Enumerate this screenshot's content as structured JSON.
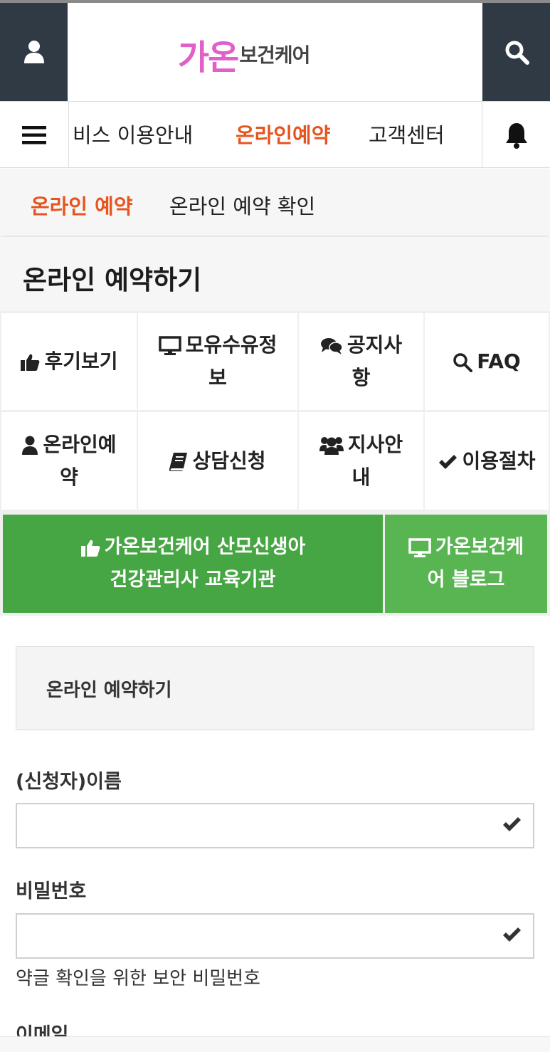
{
  "header": {
    "logo_mark": "가온",
    "logo_rest": "보건케어",
    "user_icon": "user-icon",
    "search_icon": "search-icon"
  },
  "gnb": {
    "items": [
      "비스 이용안내",
      "온라인예약",
      "고객센터"
    ],
    "active_index": 1,
    "menu_icon": "hamburger-icon",
    "bell_icon": "bell-icon"
  },
  "subnav": {
    "items": [
      "온라인 예약",
      "온라인 예약 확인"
    ],
    "active_index": 0
  },
  "page_title": "온라인 예약하기",
  "quick_menu": [
    {
      "label": "후기보기",
      "icon": "thumbs-up-icon"
    },
    {
      "label": "모유수유정보",
      "icon": "monitor-icon"
    },
    {
      "label": "공지사항",
      "icon": "comments-icon"
    },
    {
      "label": "FAQ",
      "icon": "search-icon"
    },
    {
      "label": "온라인예약",
      "icon": "user-icon"
    },
    {
      "label": "상담신청",
      "icon": "book-icon"
    },
    {
      "label": "지사안내",
      "icon": "users-icon"
    },
    {
      "label": "이용절차",
      "icon": "check-icon"
    }
  ],
  "banners": [
    {
      "line1": "가온보건케어 산모신생아",
      "line2": "건강관리사 교육기관",
      "icon": "thumbs-up-icon"
    },
    {
      "line1": "가온보건케",
      "line2": "어 블로그",
      "icon": "monitor-icon"
    }
  ],
  "form": {
    "header_title": "온라인 예약하기",
    "fields": [
      {
        "label": "(신청자)이름",
        "value": "",
        "placeholder": ""
      },
      {
        "label": "비밀번호",
        "value": "",
        "placeholder": "",
        "help": "약글 확인을 위한 보안 비밀번호"
      }
    ],
    "next_label": "이메일"
  },
  "colors": {
    "accent": "#e8541e",
    "header_dark": "#2f3a45",
    "banner_green": "#47a644",
    "banner_green_light": "#58b552",
    "logo_pink": "#e05fc8"
  }
}
